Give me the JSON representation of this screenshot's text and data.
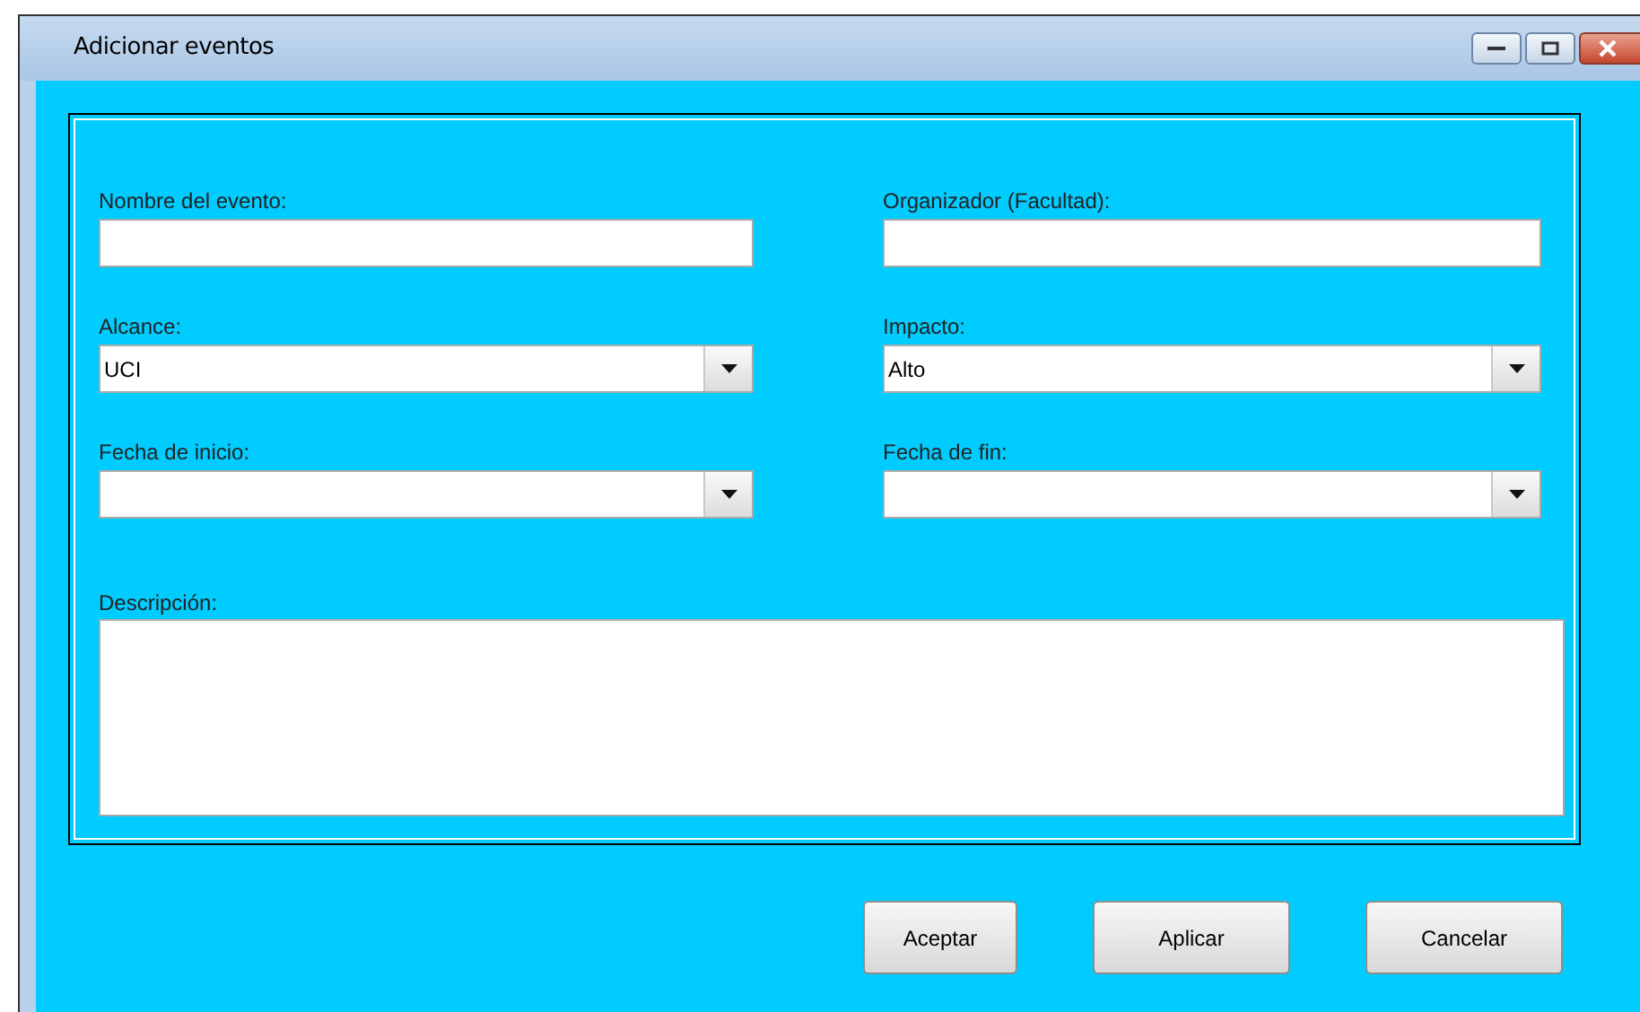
{
  "window": {
    "title": "Adicionar eventos"
  },
  "fields": [
    {
      "label": "Nombre del evento:",
      "kind": "text"
    },
    {
      "label": "Organizador (Facultad):",
      "kind": "text"
    },
    {
      "label": "Alcance:",
      "kind": "combo",
      "value": "UCI"
    },
    {
      "label": "Impacto:",
      "kind": "combo",
      "value": "Alto"
    },
    {
      "label": "Fecha de inicio:",
      "kind": "combo"
    },
    {
      "label": "Fecha de fin:",
      "kind": "combo"
    }
  ],
  "description": {
    "label": "Descripción:"
  },
  "buttons": [
    "Aceptar",
    "Aplicar",
    "Cancelar"
  ]
}
